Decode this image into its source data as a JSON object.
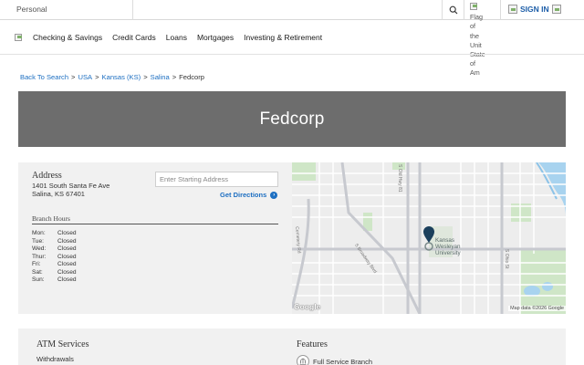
{
  "topbar": {
    "segment": "Personal",
    "search_icon": "search-icon",
    "flag_alt_words": [
      "Flag",
      "of",
      "the",
      "Unit",
      "State",
      "of",
      "Am"
    ],
    "signin_label": "SIGN IN"
  },
  "nav": {
    "items": [
      {
        "label": "Checking & Savings"
      },
      {
        "label": "Credit Cards"
      },
      {
        "label": "Loans"
      },
      {
        "label": "Mortgages"
      },
      {
        "label": "Investing & Retirement"
      }
    ]
  },
  "breadcrumb": {
    "links": [
      {
        "label": "Back To Search"
      },
      {
        "label": "USA"
      },
      {
        "label": "Kansas (KS)"
      },
      {
        "label": "Salina"
      }
    ],
    "separator": ">",
    "current": "Fedcorp"
  },
  "hero": {
    "title": "Fedcorp"
  },
  "address": {
    "title": "Address",
    "line1": "1401 South Santa Fe Ave",
    "line2": "Salina, KS 67401",
    "start_placeholder": "Enter Starting Address",
    "directions_label": "Get Directions"
  },
  "hours": {
    "title": "Branch Hours",
    "days": [
      {
        "day": "Mon:",
        "value": "Closed"
      },
      {
        "day": "Tue:",
        "value": "Closed"
      },
      {
        "day": "Wed:",
        "value": "Closed"
      },
      {
        "day": "Thur:",
        "value": "Closed"
      },
      {
        "day": "Fri:",
        "value": "Closed"
      },
      {
        "day": "Sat:",
        "value": "Closed"
      },
      {
        "day": "Sun:",
        "value": "Closed"
      }
    ]
  },
  "map": {
    "poi_line1": "Kansas",
    "poi_line2": "Wesleyan",
    "poi_line3": "University",
    "road_old_hwy": "S Old Hwy 81",
    "road_broadway": "S Broadway Blvd",
    "road_ohio": "S Ohio St",
    "road_cemetery": "Cemetery Rd",
    "google_label": "Google",
    "credit": "Map data ©2026 Google",
    "marker_color": "#1b3f5c"
  },
  "services": {
    "atm_title": "ATM Services",
    "atm_items": [
      {
        "label": "Withdrawals"
      }
    ],
    "features_title": "Features",
    "feature_items": [
      {
        "label": "Full Service Branch"
      }
    ]
  },
  "colors": {
    "link": "#1d6fc2",
    "hero_bg": "#6d6d6d",
    "card_bg": "#f1f1f1"
  }
}
